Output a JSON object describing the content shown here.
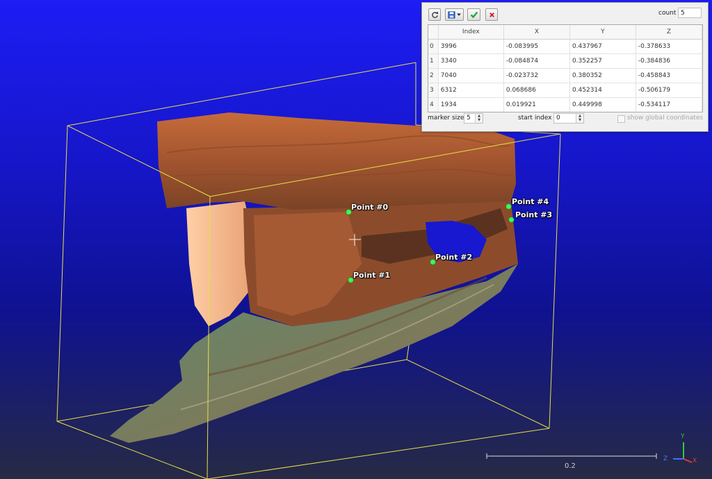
{
  "viewport": {
    "points": [
      {
        "label": "Point #0"
      },
      {
        "label": "Point #1"
      },
      {
        "label": "Point #2"
      },
      {
        "label": "Point #3"
      },
      {
        "label": "Point #4"
      }
    ],
    "scale_bar_label": "0.2",
    "axes": {
      "x": "X",
      "y": "Y",
      "z": "Z"
    },
    "colors": {
      "bbox": "#e8e04a",
      "marker": "#34ff5e",
      "background_top": "#1d1df5",
      "background_bottom": "#262a44"
    }
  },
  "panel": {
    "toolbar": {
      "reset_icon": "refresh-icon",
      "save_icon": "floppy-disk-icon",
      "confirm_icon": "checkmark-icon",
      "close_icon": "close-x-icon"
    },
    "count_label": "count",
    "count_value": "5",
    "table": {
      "headers": [
        "Index",
        "X",
        "Y",
        "Z"
      ],
      "rows": [
        {
          "row": "0",
          "index": "3996",
          "x": "-0.083995",
          "y": "0.437967",
          "z": "-0.378633"
        },
        {
          "row": "1",
          "index": "3340",
          "x": "-0.084874",
          "y": "0.352257",
          "z": "-0.384836"
        },
        {
          "row": "2",
          "index": "7040",
          "x": "-0.023732",
          "y": "0.380352",
          "z": "-0.458843"
        },
        {
          "row": "3",
          "index": "6312",
          "x": "0.068686",
          "y": "0.452314",
          "z": "-0.506179"
        },
        {
          "row": "4",
          "index": "1934",
          "x": "0.019921",
          "y": "0.449998",
          "z": "-0.534117"
        }
      ]
    },
    "marker_size_label": "marker size",
    "marker_size_value": "5",
    "start_index_label": "start index",
    "start_index_value": "0",
    "global_coords_label": "show global coordinates",
    "global_coords_checked": false
  }
}
